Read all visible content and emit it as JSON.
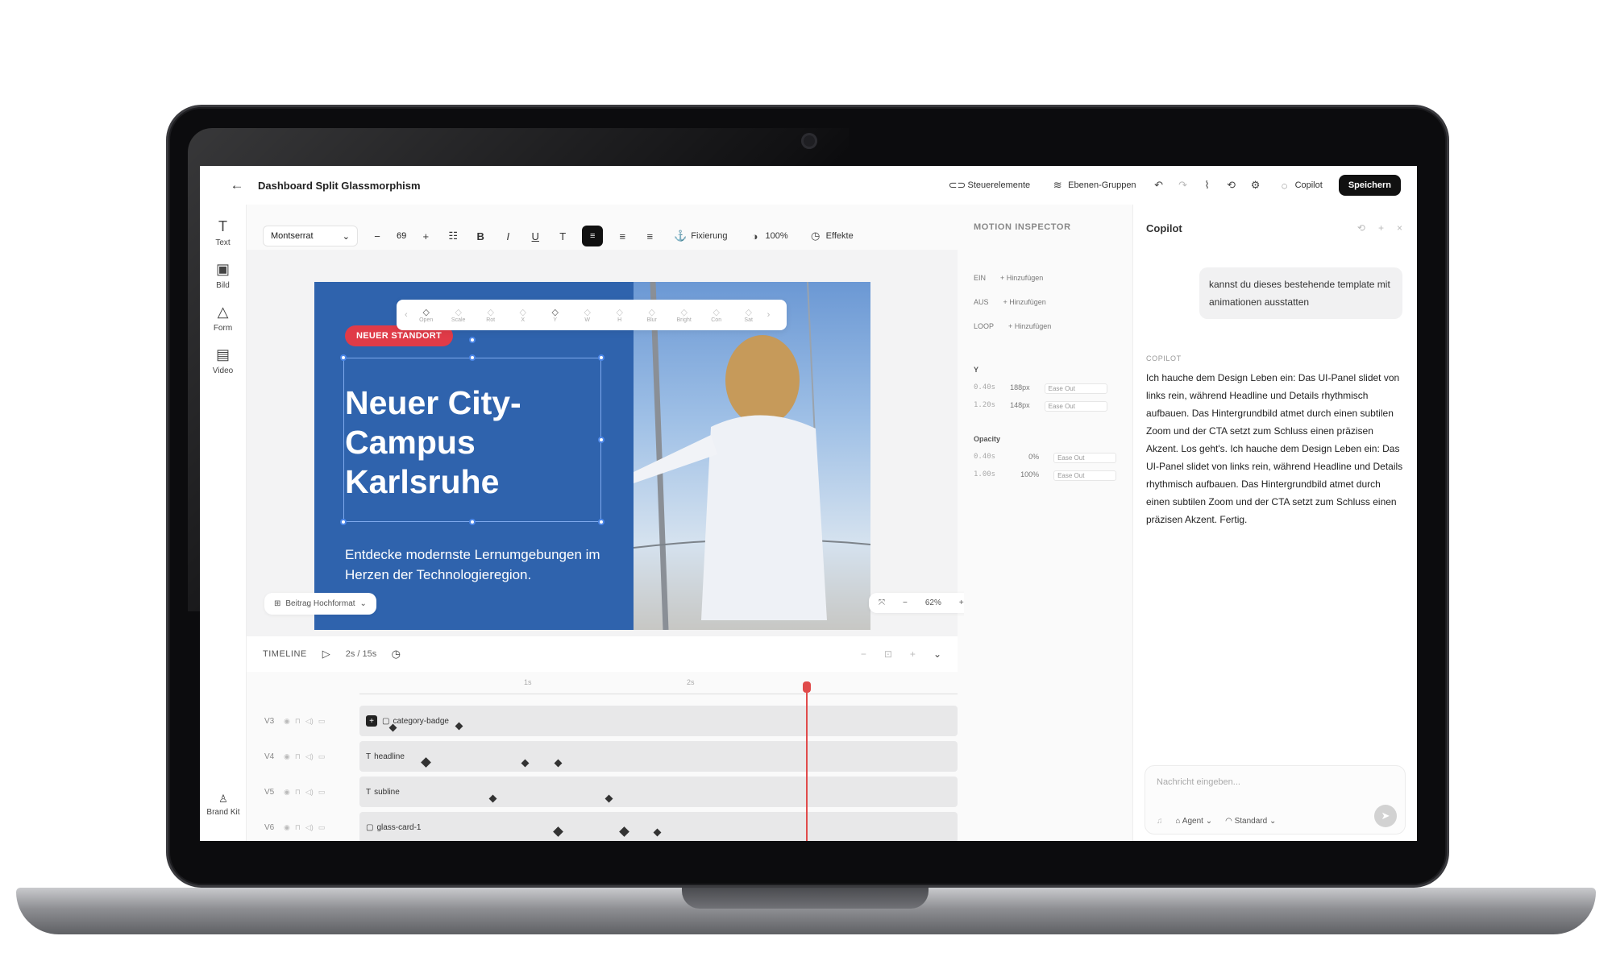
{
  "app": {
    "doc_title": "Dashboard Split Glassmorphism",
    "actions": {
      "controls": "Steuerelemente",
      "layer_groups": "Ebenen-Gruppen",
      "copilot": "Copilot",
      "save": "Speichern"
    }
  },
  "left_rail": [
    {
      "label": "Text",
      "icon": "text-icon"
    },
    {
      "label": "Bild",
      "icon": "image-icon"
    },
    {
      "label": "Form",
      "icon": "shapes-icon"
    },
    {
      "label": "Video",
      "icon": "film-icon"
    }
  ],
  "brand_kit": "Brand Kit",
  "format_bar": {
    "font": "Montserrat",
    "size": "69",
    "anchor": "Fixierung",
    "opacity": "100%",
    "effects": "Effekte"
  },
  "canvas": {
    "badge": "NEUER STANDORT",
    "headline": "Neuer City-Campus Karlsruhe",
    "subline": "Entdecke modernste Lernumgebungen im Herzen der Technologieregion.",
    "format_pill": "Beitrag Hochformat",
    "zoom": "62%",
    "anim_items": [
      "Open",
      "Scale",
      "Rot",
      "X",
      "Y",
      "W",
      "H",
      "Blur",
      "Bright",
      "Con",
      "Sat"
    ]
  },
  "timeline": {
    "label": "TIMELINE",
    "time": "2s / 15s",
    "ruler": [
      "1s",
      "2s"
    ],
    "tracks": [
      {
        "id": "V3",
        "name": "category-badge"
      },
      {
        "id": "V4",
        "name": "headline"
      },
      {
        "id": "V5",
        "name": "subline"
      },
      {
        "id": "V6",
        "name": "glass-card-1"
      }
    ]
  },
  "inspector": {
    "title": "MOTION INSPECTOR",
    "in_label": "EIN",
    "out_label": "AUS",
    "loop_label": "LOOP",
    "add": "+ Hinzufügen",
    "y_label": "Y",
    "y_rows": [
      {
        "t": "0.40s",
        "v": "188px",
        "ease": "Ease Out"
      },
      {
        "t": "1.20s",
        "v": "148px",
        "ease": "Ease Out"
      }
    ],
    "op_label": "Opacity",
    "op_rows": [
      {
        "t": "0.40s",
        "v": "0%",
        "ease": "Ease Out"
      },
      {
        "t": "1.00s",
        "v": "100%",
        "ease": "Ease Out"
      }
    ]
  },
  "copilot": {
    "title": "Copilot",
    "user_message": "kannst du dieses bestehende template mit animationen ausstatten",
    "label": "COPILOT",
    "reply": "Ich hauche dem Design Leben ein: Das UI-Panel slidet von links rein, während Headline und Details rhythmisch aufbauen. Das Hintergrundbild atmet durch einen subtilen Zoom und der CTA setzt zum Schluss einen präzisen Akzent. Los geht's. Ich hauche dem Design Leben ein: Das UI-Panel slidet von links rein, während Headline und Details rhythmisch aufbauen. Das Hintergrundbild atmet durch einen subtilen Zoom und der CTA setzt zum Schluss einen präzisen Akzent. Fertig.",
    "input_placeholder": "Nachricht eingeben...",
    "mode": "Agent",
    "model": "Standard"
  }
}
